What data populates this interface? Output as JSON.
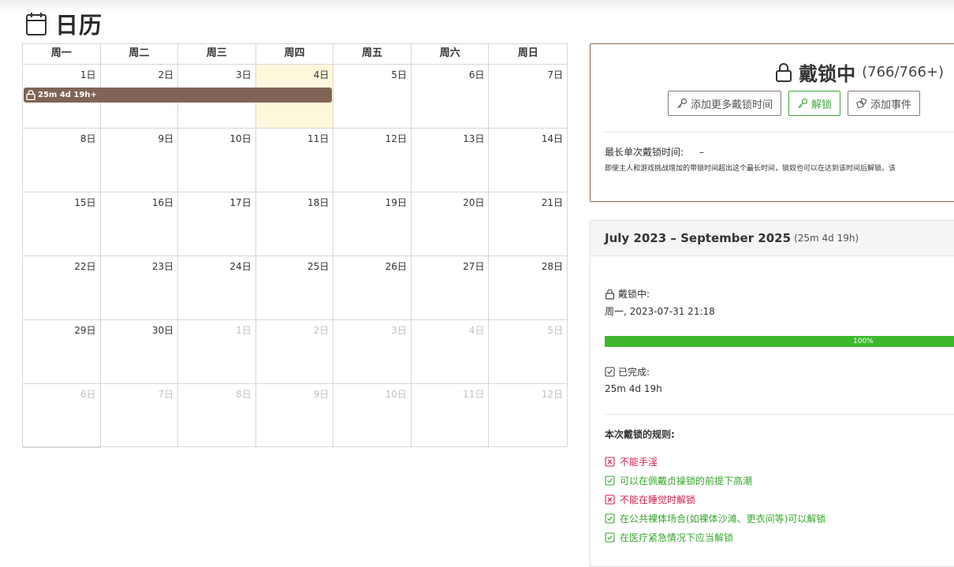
{
  "page": {
    "title": "日历",
    "icon": "calendar-icon"
  },
  "calendar": {
    "weekdays": [
      "周一",
      "周二",
      "周三",
      "周四",
      "周五",
      "周六",
      "周日"
    ],
    "days": [
      {
        "label": "1日",
        "other": false
      },
      {
        "label": "2日",
        "other": false
      },
      {
        "label": "3日",
        "other": false
      },
      {
        "label": "4日",
        "other": false,
        "today": true
      },
      {
        "label": "5日",
        "other": false
      },
      {
        "label": "6日",
        "other": false
      },
      {
        "label": "7日",
        "other": false
      },
      {
        "label": "8日",
        "other": false
      },
      {
        "label": "9日",
        "other": false
      },
      {
        "label": "10日",
        "other": false
      },
      {
        "label": "11日",
        "other": false
      },
      {
        "label": "12日",
        "other": false
      },
      {
        "label": "13日",
        "other": false
      },
      {
        "label": "14日",
        "other": false
      },
      {
        "label": "15日",
        "other": false
      },
      {
        "label": "16日",
        "other": false
      },
      {
        "label": "17日",
        "other": false
      },
      {
        "label": "18日",
        "other": false
      },
      {
        "label": "19日",
        "other": false
      },
      {
        "label": "20日",
        "other": false
      },
      {
        "label": "21日",
        "other": false
      },
      {
        "label": "22日",
        "other": false
      },
      {
        "label": "23日",
        "other": false
      },
      {
        "label": "24日",
        "other": false
      },
      {
        "label": "25日",
        "other": false
      },
      {
        "label": "26日",
        "other": false
      },
      {
        "label": "27日",
        "other": false
      },
      {
        "label": "28日",
        "other": false
      },
      {
        "label": "29日",
        "other": false
      },
      {
        "label": "30日",
        "other": false
      },
      {
        "label": "1日",
        "other": true
      },
      {
        "label": "2日",
        "other": true
      },
      {
        "label": "3日",
        "other": true
      },
      {
        "label": "4日",
        "other": true
      },
      {
        "label": "5日",
        "other": true
      },
      {
        "label": "6日",
        "other": true
      },
      {
        "label": "7日",
        "other": true
      },
      {
        "label": "8日",
        "other": true
      },
      {
        "label": "9日",
        "other": true
      },
      {
        "label": "10日",
        "other": true
      },
      {
        "label": "11日",
        "other": true
      },
      {
        "label": "12日",
        "other": true
      }
    ],
    "event": {
      "label": "25m 4d 19h+",
      "color": "#806455",
      "icon": "lock-icon"
    }
  },
  "status": {
    "title": "戴锁中",
    "count": "(766/766+)",
    "buttons": {
      "add_time": "添加更多戴锁时间",
      "unlock": "解锁",
      "add_event": "添加事件"
    },
    "max_lock_label": "最长单次戴锁时间:",
    "max_lock_value": "–",
    "max_lock_note": "即使主人和游戏挑战增加的带锁时间超出这个最长时间，锁奴也可以在达到该时间后解锁。该"
  },
  "session": {
    "title": "July 2023 – September 2025",
    "duration": "(25m 4d 19h)",
    "locked_label": "戴锁中:",
    "locked_value": "周一, 2023-07-31 21:18",
    "progress_percent": 100,
    "progress_label": "100%",
    "completed_label": "已完成:",
    "completed_value": "25m 4d 19h",
    "rules_title": "本次戴锁的规则:",
    "rules": [
      {
        "text": "不能手淫",
        "allowed": false
      },
      {
        "text": "可以在佩戴贞操锁的前提下高潮",
        "allowed": true
      },
      {
        "text": "不能在睡觉时解锁",
        "allowed": false
      },
      {
        "text": "在公共裸体场合(如裸体沙滩、更衣间等)可以解锁",
        "allowed": true
      },
      {
        "text": "在医疗紧急情况下应当解锁",
        "allowed": true
      }
    ],
    "colors": {
      "progress": "#3db82d",
      "allowed": "#37a62e",
      "forbidden": "#d6204a"
    }
  }
}
